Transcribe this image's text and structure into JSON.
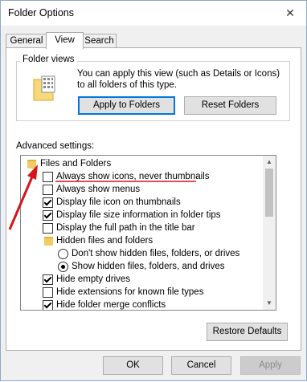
{
  "window": {
    "title": "Folder Options",
    "close_glyph": "✕"
  },
  "tabs": [
    {
      "label": "General"
    },
    {
      "label": "View"
    },
    {
      "label": "Search"
    }
  ],
  "folder_views": {
    "group_label": "Folder views",
    "description": "You can apply this view (such as Details or Icons) to all folders of this type.",
    "apply_button": "Apply to Folders",
    "reset_button": "Reset Folders"
  },
  "advanced": {
    "label": "Advanced settings:",
    "items": [
      {
        "type": "folder",
        "label": "Files and Folders"
      },
      {
        "type": "checkbox",
        "checked": false,
        "label": "Always show icons, never thumbnails"
      },
      {
        "type": "checkbox",
        "checked": false,
        "label": "Always show menus"
      },
      {
        "type": "checkbox",
        "checked": true,
        "label": "Display file icon on thumbnails"
      },
      {
        "type": "checkbox",
        "checked": true,
        "label": "Display file size information in folder tips"
      },
      {
        "type": "checkbox",
        "checked": false,
        "label": "Display the full path in the title bar"
      },
      {
        "type": "folder",
        "label": "Hidden files and folders"
      },
      {
        "type": "radio",
        "checked": false,
        "label": "Don't show hidden files, folders, or drives"
      },
      {
        "type": "radio",
        "checked": true,
        "label": "Show hidden files, folders, and drives"
      },
      {
        "type": "checkbox",
        "checked": true,
        "label": "Hide empty drives"
      },
      {
        "type": "checkbox",
        "checked": false,
        "label": "Hide extensions for known file types"
      },
      {
        "type": "checkbox",
        "checked": true,
        "label": "Hide folder merge conflicts"
      }
    ],
    "restore_button": "Restore Defaults"
  },
  "footer": {
    "ok": "OK",
    "cancel": "Cancel",
    "apply": "Apply"
  },
  "colors": {
    "annotation": "#d7141a",
    "accent": "#0078d7",
    "folder": "#f2cd63"
  }
}
